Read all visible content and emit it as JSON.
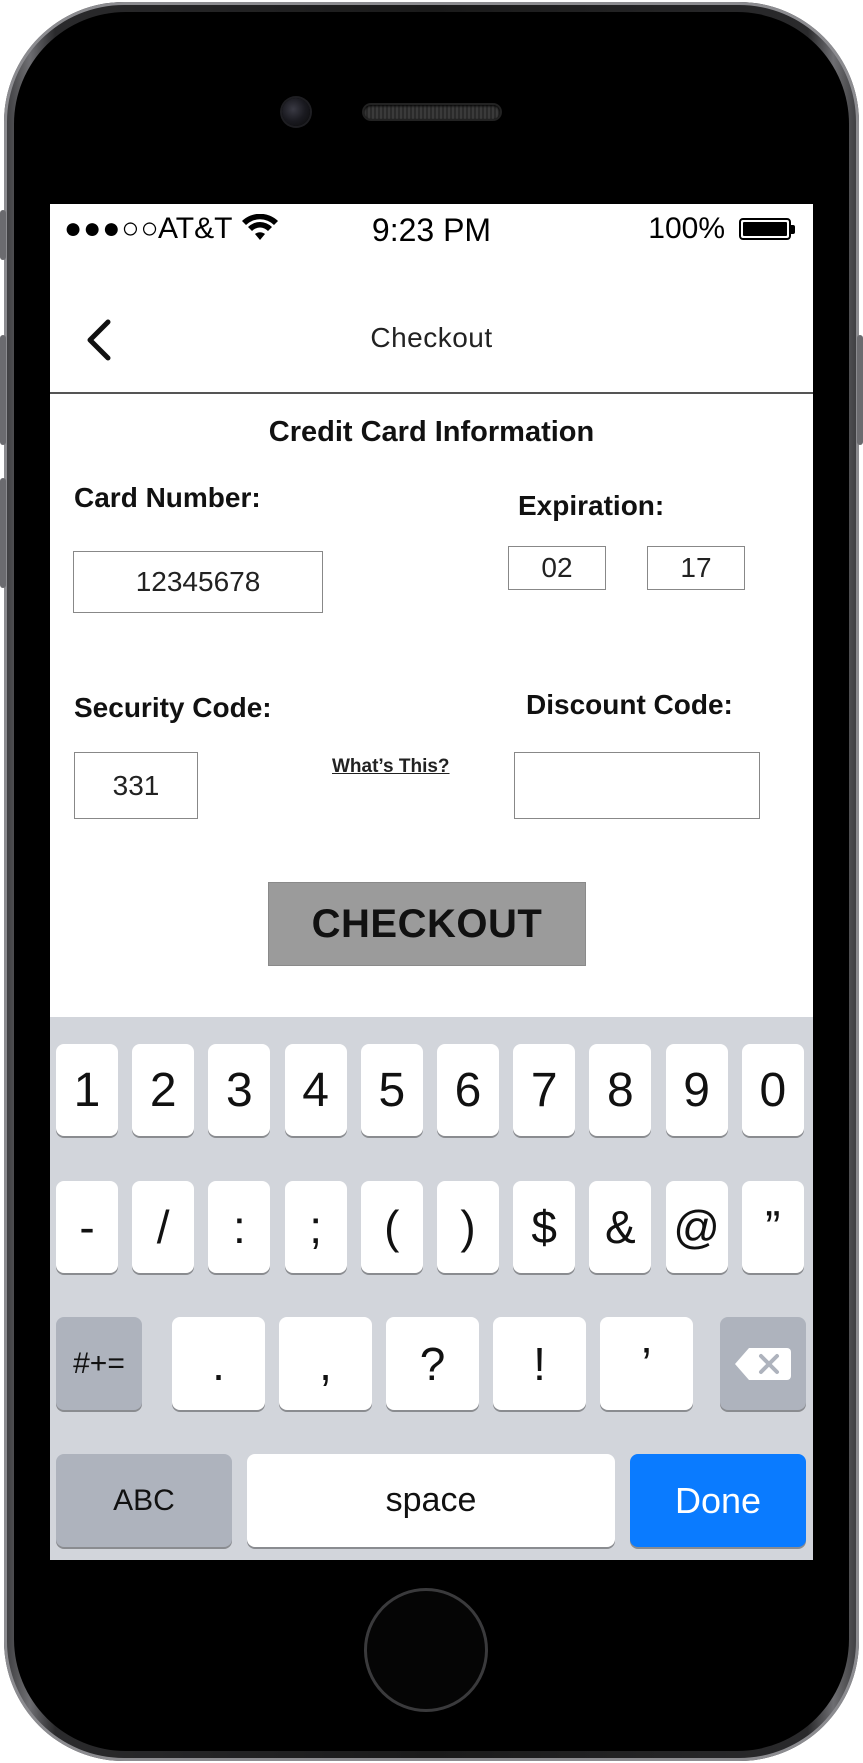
{
  "status_bar": {
    "signal": "●●●○○",
    "carrier": "AT&T",
    "time": "9:23 PM",
    "battery_percent": "100%",
    "battery_level": 1.0
  },
  "nav": {
    "title": "Checkout",
    "back_icon": "chevron-left-icon"
  },
  "form": {
    "section_title": "Credit Card Information",
    "card_number_label": "Card Number:",
    "card_number_value": "12345678",
    "expiration_label": "Expiration:",
    "expiration_month": "02",
    "expiration_year": "17",
    "security_code_label": "Security Code:",
    "security_code_value": "331",
    "whats_this_link": "What’s This?",
    "discount_code_label": "Discount Code:",
    "discount_code_value": "",
    "checkout_button": "CHECKOUT"
  },
  "keyboard": {
    "row1": [
      "1",
      "2",
      "3",
      "4",
      "5",
      "6",
      "7",
      "8",
      "9",
      "0"
    ],
    "row2": [
      "-",
      "/",
      ":",
      ";",
      "(",
      ")",
      "$",
      "&",
      "@",
      "”"
    ],
    "row3_mode": "#+=",
    "row3": [
      ".",
      ",",
      "?",
      "!",
      "’"
    ],
    "delete_icon": "backspace-icon",
    "abc_label": "ABC",
    "space_label": "space",
    "done_label": "Done",
    "done_color": "#0a7bff"
  }
}
